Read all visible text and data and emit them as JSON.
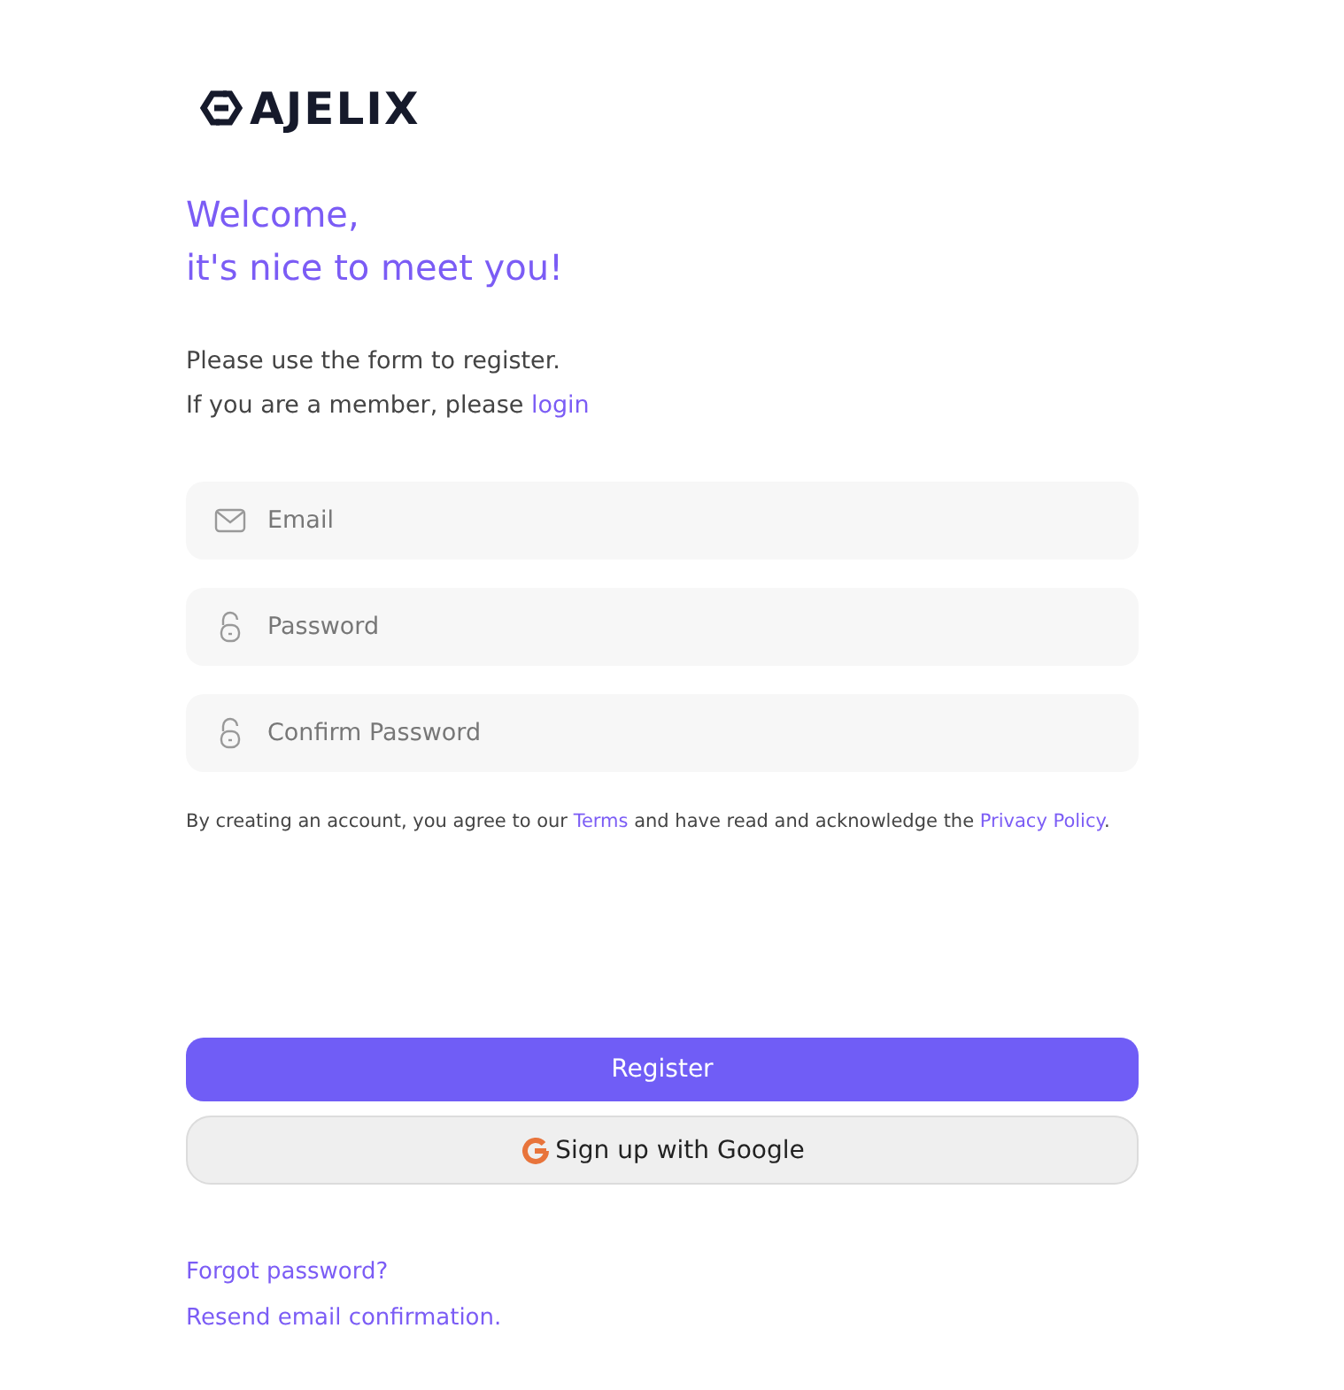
{
  "logo": {
    "text": "AJELIX"
  },
  "heading": [
    "Welcome,",
    "it's nice to meet you!"
  ],
  "intro": {
    "line1": "Please use the form to register.",
    "line2": "If you are a member, please ",
    "link": "login"
  },
  "fields": [
    {
      "kind": "email",
      "placeholder": "Email"
    },
    {
      "kind": "password",
      "placeholder": "Password"
    },
    {
      "kind": "password",
      "placeholder": "Confirm Password"
    }
  ],
  "terms": {
    "before": "By creating an account, you agree to our ",
    "terms_link": "Terms",
    "middle": " and have read and acknowledge the ",
    "privacy_link": "Privacy Policy",
    "after": "."
  },
  "register_button": "Register",
  "google_button": "Sign up with Google",
  "links": [
    "Forgot password?",
    "Resend email confirmation."
  ]
}
